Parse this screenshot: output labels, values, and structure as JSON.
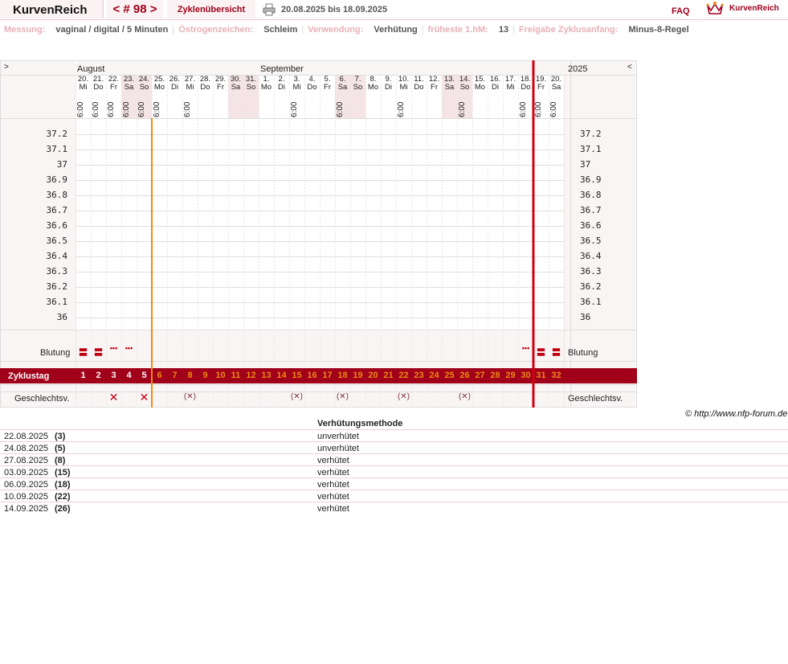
{
  "header": {
    "logo": "KurvenReich",
    "cycle_nav": "< # 98 >",
    "overview_tab": "Zyklenübersicht",
    "date_range": "20.08.2025 bis 18.09.2025",
    "faq": "FAQ",
    "brand": "KurvenReich"
  },
  "settings": [
    {
      "label": "Messung:",
      "value": "vaginal / digital / 5 Minuten"
    },
    {
      "label": "Östrogenzeichen:",
      "value": "Schleim"
    },
    {
      "label": "Verwendung:",
      "value": "Verhütung"
    },
    {
      "label": "früheste 1.hM:",
      "value": "13"
    },
    {
      "label": "Freigabe Zyklusanfang:",
      "value": "Minus-8-Regel"
    }
  ],
  "chart": {
    "nav_prev": ">",
    "nav_next": "<",
    "year": "2025",
    "months": [
      "August",
      "September"
    ],
    "days": [
      {
        "d": "20.",
        "w": "Mi",
        "t": "6:00"
      },
      {
        "d": "21.",
        "w": "Do",
        "t": "6:00"
      },
      {
        "d": "22.",
        "w": "Fr",
        "t": "6:00"
      },
      {
        "d": "23.",
        "w": "Sa",
        "t": "6:00"
      },
      {
        "d": "24.",
        "w": "So",
        "t": "6:00"
      },
      {
        "d": "25.",
        "w": "Mo",
        "t": "6:00"
      },
      {
        "d": "26.",
        "w": "Di",
        "t": ""
      },
      {
        "d": "27.",
        "w": "Mi",
        "t": "6:00"
      },
      {
        "d": "28.",
        "w": "Do",
        "t": ""
      },
      {
        "d": "29.",
        "w": "Fr",
        "t": ""
      },
      {
        "d": "30.",
        "w": "Sa",
        "t": ""
      },
      {
        "d": "31.",
        "w": "So",
        "t": ""
      },
      {
        "d": "1.",
        "w": "Mo",
        "t": ""
      },
      {
        "d": "2.",
        "w": "Di",
        "t": ""
      },
      {
        "d": "3.",
        "w": "Mi",
        "t": "6:00"
      },
      {
        "d": "4.",
        "w": "Do",
        "t": ""
      },
      {
        "d": "5.",
        "w": "Fr",
        "t": ""
      },
      {
        "d": "6.",
        "w": "Sa",
        "t": "6:00"
      },
      {
        "d": "7.",
        "w": "So",
        "t": ""
      },
      {
        "d": "8.",
        "w": "Mo",
        "t": ""
      },
      {
        "d": "9.",
        "w": "Di",
        "t": ""
      },
      {
        "d": "10.",
        "w": "Mi",
        "t": "6:00"
      },
      {
        "d": "11.",
        "w": "Do",
        "t": ""
      },
      {
        "d": "12.",
        "w": "Fr",
        "t": ""
      },
      {
        "d": "13.",
        "w": "Sa",
        "t": ""
      },
      {
        "d": "14.",
        "w": "So",
        "t": "6:00"
      },
      {
        "d": "15.",
        "w": "Mo",
        "t": ""
      },
      {
        "d": "16.",
        "w": "Di",
        "t": ""
      },
      {
        "d": "17.",
        "w": "Mi",
        "t": ""
      },
      {
        "d": "18.",
        "w": "Do",
        "t": "6:00"
      },
      {
        "d": "19.",
        "w": "Fr",
        "t": "6:00"
      },
      {
        "d": "20.",
        "w": "Sa",
        "t": "6:00"
      }
    ],
    "weekend_shade": [
      3,
      4,
      10,
      11,
      17,
      18,
      24,
      25
    ],
    "temperatures": [
      "37.2",
      "37.1",
      "37",
      "36.9",
      "36.8",
      "36.7",
      "36.6",
      "36.5",
      "36.4",
      "36.3",
      "36.2",
      "36.1",
      "36"
    ],
    "row_bleeding": "Blutung",
    "bleeding": [
      {
        "day": 0,
        "sym": "〓"
      },
      {
        "day": 1,
        "sym": "〓"
      },
      {
        "day": 2,
        "sym": "•••"
      },
      {
        "day": 3,
        "sym": "•••"
      },
      {
        "day": 29,
        "sym": "•••"
      },
      {
        "day": 30,
        "sym": "〓"
      },
      {
        "day": 31,
        "sym": "〓"
      }
    ],
    "row_cycleday": "Zyklustag",
    "cycle_days": [
      "1",
      "2",
      "3",
      "4",
      "5",
      "6",
      "7",
      "8",
      "9",
      "10",
      "11",
      "12",
      "13",
      "14",
      "15",
      "16",
      "17",
      "18",
      "19",
      "20",
      "21",
      "22",
      "23",
      "24",
      "25",
      "26",
      "27",
      "28",
      "29",
      "30",
      "31",
      "32"
    ],
    "cycle_white_count": 5,
    "row_sex": "Geschlechtsv.",
    "sex": [
      {
        "day": 2,
        "sym": "✕",
        "kind": "plain"
      },
      {
        "day": 4,
        "sym": "✕",
        "kind": "plain"
      },
      {
        "day": 7,
        "sym": "(✕)",
        "kind": "prot"
      },
      {
        "day": 14,
        "sym": "(✕)",
        "kind": "prot"
      },
      {
        "day": 17,
        "sym": "(✕)",
        "kind": "prot"
      },
      {
        "day": 21,
        "sym": "(✕)",
        "kind": "prot"
      },
      {
        "day": 25,
        "sym": "(✕)",
        "kind": "prot"
      }
    ],
    "orange_line_after_day": 4,
    "red_line_after_day": 29,
    "colors": {
      "accent": "#a0001a",
      "orange": "#f08a10",
      "red": "#d00010",
      "shade": "#f4e4e6",
      "grid": "#e6dcdd"
    }
  },
  "copyright": "© http://www.nfp-forum.de",
  "table": {
    "header": "Verhütungsmethode",
    "rows": [
      {
        "date": "22.08.2025",
        "num": "(3)",
        "method": "unverhütet"
      },
      {
        "date": "24.08.2025",
        "num": "(5)",
        "method": "unverhütet"
      },
      {
        "date": "27.08.2025",
        "num": "(8)",
        "method": "verhütet"
      },
      {
        "date": "03.09.2025",
        "num": "(15)",
        "method": "verhütet"
      },
      {
        "date": "06.09.2025",
        "num": "(18)",
        "method": "verhütet"
      },
      {
        "date": "10.09.2025",
        "num": "(22)",
        "method": "verhütet"
      },
      {
        "date": "14.09.2025",
        "num": "(26)",
        "method": "verhütet"
      }
    ]
  }
}
